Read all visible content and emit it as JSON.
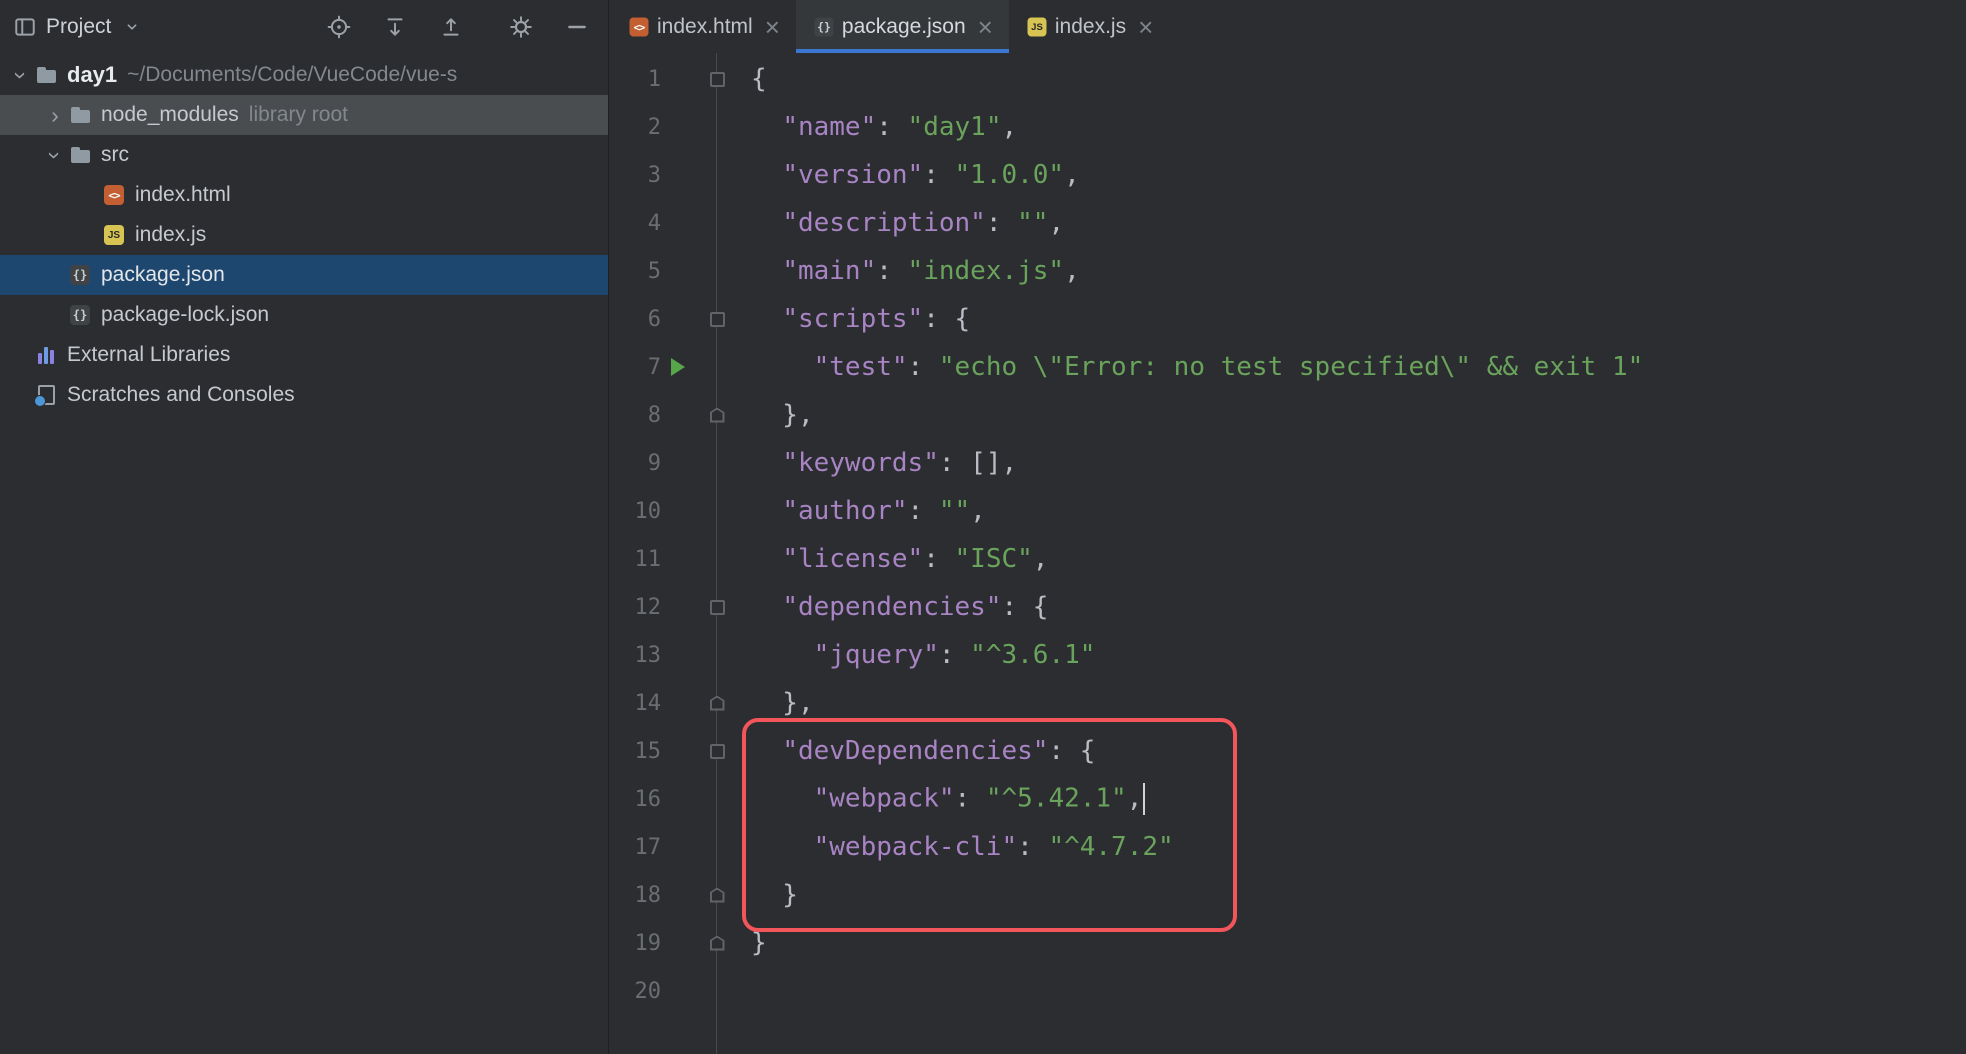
{
  "project_panel": {
    "title": "Project",
    "tree": [
      {
        "label": "day1",
        "suffix": "~/Documents/Code/VueCode/vue-s",
        "icon": "folder",
        "chevron": "expanded",
        "indent": 0,
        "bold": true
      },
      {
        "label": "node_modules",
        "suffix": "library root",
        "icon": "folder",
        "chevron": "collapsed",
        "indent": 1,
        "state": "highlighted"
      },
      {
        "label": "src",
        "icon": "folder",
        "chevron": "expanded",
        "indent": 1
      },
      {
        "label": "index.html",
        "icon": "html",
        "indent": 2
      },
      {
        "label": "index.js",
        "icon": "js",
        "indent": 2
      },
      {
        "label": "package.json",
        "icon": "json",
        "indent": 1,
        "state": "selected"
      },
      {
        "label": "package-lock.json",
        "icon": "json",
        "indent": 1
      },
      {
        "label": "External Libraries",
        "icon": "library",
        "indent": 0
      },
      {
        "label": "Scratches and Consoles",
        "icon": "scratches",
        "indent": 0
      }
    ]
  },
  "tabs": [
    {
      "label": "index.html",
      "icon": "html",
      "active": false
    },
    {
      "label": "package.json",
      "icon": "json",
      "active": true
    },
    {
      "label": "index.js",
      "icon": "js",
      "active": false
    }
  ],
  "editor": {
    "run_line": 7,
    "caret_line": 16,
    "lines": [
      {
        "num": 1,
        "fold": "start",
        "tokens": [
          [
            "{",
            "p"
          ]
        ]
      },
      {
        "num": 2,
        "tokens": [
          [
            "  ",
            "p"
          ],
          [
            "\"name\"",
            "k"
          ],
          [
            ": ",
            "p"
          ],
          [
            "\"day1\"",
            "s"
          ],
          [
            ",",
            "p"
          ]
        ]
      },
      {
        "num": 3,
        "tokens": [
          [
            "  ",
            "p"
          ],
          [
            "\"version\"",
            "k"
          ],
          [
            ": ",
            "p"
          ],
          [
            "\"1.0.0\"",
            "s"
          ],
          [
            ",",
            "p"
          ]
        ]
      },
      {
        "num": 4,
        "tokens": [
          [
            "  ",
            "p"
          ],
          [
            "\"description\"",
            "k"
          ],
          [
            ": ",
            "p"
          ],
          [
            "\"\"",
            "s"
          ],
          [
            ",",
            "p"
          ]
        ]
      },
      {
        "num": 5,
        "tokens": [
          [
            "  ",
            "p"
          ],
          [
            "\"main\"",
            "k"
          ],
          [
            ": ",
            "p"
          ],
          [
            "\"index.js\"",
            "s"
          ],
          [
            ",",
            "p"
          ]
        ]
      },
      {
        "num": 6,
        "fold": "start",
        "tokens": [
          [
            "  ",
            "p"
          ],
          [
            "\"scripts\"",
            "k"
          ],
          [
            ": {",
            "p"
          ]
        ]
      },
      {
        "num": 7,
        "tokens": [
          [
            "    ",
            "p"
          ],
          [
            "\"test\"",
            "k"
          ],
          [
            ": ",
            "p"
          ],
          [
            "\"echo \\\"Error: no test specified\\\" && exit 1\"",
            "s"
          ]
        ]
      },
      {
        "num": 8,
        "fold": "end",
        "tokens": [
          [
            "  },",
            "p"
          ]
        ]
      },
      {
        "num": 9,
        "tokens": [
          [
            "  ",
            "p"
          ],
          [
            "\"keywords\"",
            "k"
          ],
          [
            ": ",
            "p"
          ],
          [
            "[],",
            "p"
          ]
        ]
      },
      {
        "num": 10,
        "tokens": [
          [
            "  ",
            "p"
          ],
          [
            "\"author\"",
            "k"
          ],
          [
            ": ",
            "p"
          ],
          [
            "\"\"",
            "s"
          ],
          [
            ",",
            "p"
          ]
        ]
      },
      {
        "num": 11,
        "tokens": [
          [
            "  ",
            "p"
          ],
          [
            "\"license\"",
            "k"
          ],
          [
            ": ",
            "p"
          ],
          [
            "\"ISC\"",
            "s"
          ],
          [
            ",",
            "p"
          ]
        ]
      },
      {
        "num": 12,
        "fold": "start",
        "tokens": [
          [
            "  ",
            "p"
          ],
          [
            "\"dependencies\"",
            "k"
          ],
          [
            ": {",
            "p"
          ]
        ]
      },
      {
        "num": 13,
        "tokens": [
          [
            "    ",
            "p"
          ],
          [
            "\"jquery\"",
            "k"
          ],
          [
            ": ",
            "p"
          ],
          [
            "\"^3.6.1\"",
            "s"
          ]
        ]
      },
      {
        "num": 14,
        "fold": "end",
        "tokens": [
          [
            "  },",
            "p"
          ]
        ]
      },
      {
        "num": 15,
        "fold": "start",
        "tokens": [
          [
            "  ",
            "p"
          ],
          [
            "\"devDependencies\"",
            "k"
          ],
          [
            ": {",
            "p"
          ]
        ]
      },
      {
        "num": 16,
        "tokens": [
          [
            "    ",
            "p"
          ],
          [
            "\"webpack\"",
            "k"
          ],
          [
            ": ",
            "p"
          ],
          [
            "\"^5.42.1\"",
            "s"
          ],
          [
            ",",
            "p"
          ]
        ]
      },
      {
        "num": 17,
        "tokens": [
          [
            "    ",
            "p"
          ],
          [
            "\"webpack-cli\"",
            "k"
          ],
          [
            ": ",
            "p"
          ],
          [
            "\"^4.7.2\"",
            "s"
          ]
        ]
      },
      {
        "num": 18,
        "fold": "end",
        "tokens": [
          [
            "  }",
            "p"
          ]
        ]
      },
      {
        "num": 19,
        "fold": "end",
        "tokens": [
          [
            "}",
            "p"
          ]
        ]
      },
      {
        "num": 20,
        "tokens": []
      }
    ]
  },
  "annotation": {
    "target_lines": "15-18",
    "color": "#f2555a"
  },
  "glyphs": {
    "chevron": "›",
    "close": "×",
    "html": "<>",
    "js": "JS",
    "json": "{}"
  },
  "colors": {
    "editor_bg": "#2b2d30",
    "key_purple": "#a884c4",
    "string_green": "#6aa35c",
    "punctuation": "#b9bdc3",
    "line_number": "#6a6d71",
    "selection_blue": "#1d476e",
    "row_highlight": "#4a4d50",
    "tab_accent_blue": "#3b77d1",
    "annotation_red": "#f2555a",
    "run_arrow_green": "#57a64a",
    "caret": "#ced3d8",
    "muted_text": "#83888e"
  }
}
